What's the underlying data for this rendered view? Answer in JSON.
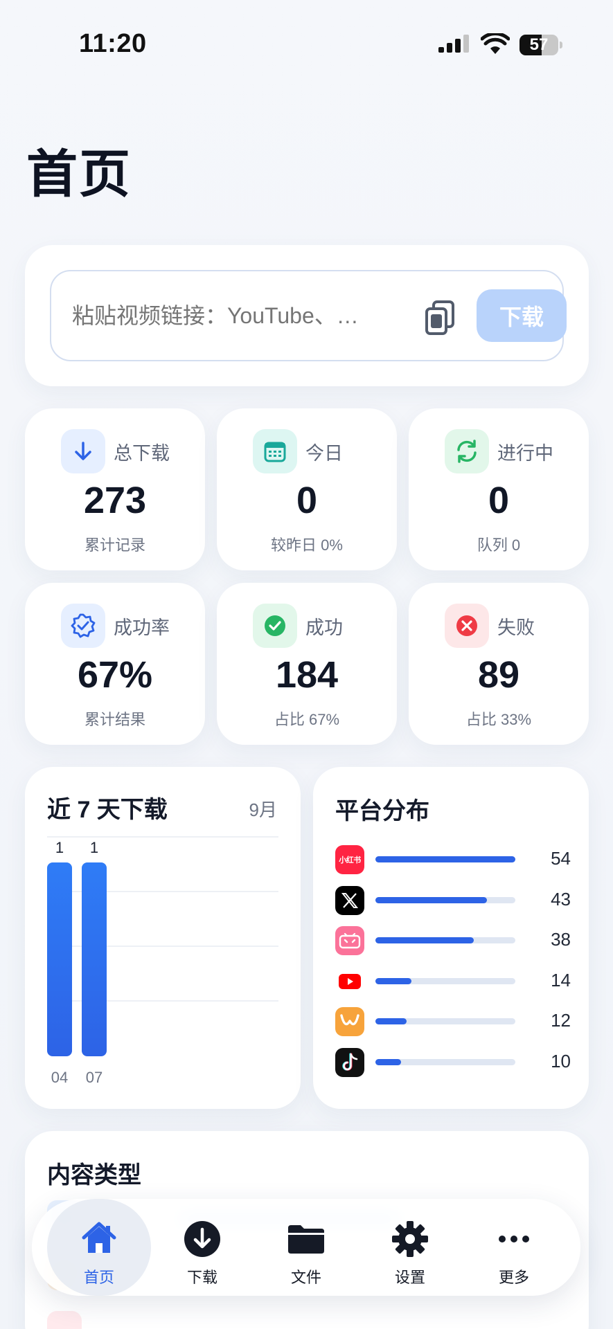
{
  "status_bar": {
    "time": "11:20",
    "battery": "57",
    "battery_level": 0.57
  },
  "page": {
    "title": "首页"
  },
  "search": {
    "placeholder": "粘贴视频链接：YouTube、…",
    "download_label": "下载"
  },
  "stats": [
    {
      "label": "总下载",
      "value": "273",
      "sub": "累计记录",
      "icon": "download-arrow-icon",
      "color": "#2d63e6",
      "bg": "#e6efff"
    },
    {
      "label": "今日",
      "value": "0",
      "sub": "较昨日 0%",
      "icon": "calendar-icon",
      "color": "#19a89a",
      "bg": "#ddf6f2"
    },
    {
      "label": "进行中",
      "value": "0",
      "sub": "队列 0",
      "icon": "sync-icon",
      "color": "#27b564",
      "bg": "#e2f7ea"
    },
    {
      "label": "成功率",
      "value": "67%",
      "sub": "累计结果",
      "icon": "verified-badge-icon",
      "color": "#2d63e6",
      "bg": "#e6efff"
    },
    {
      "label": "成功",
      "value": "184",
      "sub": "占比 67%",
      "icon": "check-circle-icon",
      "color": "#27b564",
      "bg": "#e2f7ea"
    },
    {
      "label": "失败",
      "value": "89",
      "sub": "占比 33%",
      "icon": "x-circle-icon",
      "color": "#ef3b45",
      "bg": "#fde7e8"
    }
  ],
  "chart_data": {
    "type": "bar",
    "title": "近 7 天下载",
    "month_label": "9月",
    "categories": [
      "04",
      "07"
    ],
    "values": [
      1,
      1
    ],
    "ylim": [
      0,
      1
    ],
    "grid": true,
    "color": "#2d63e6"
  },
  "platforms": {
    "title": "平台分布",
    "max": 54,
    "items": [
      {
        "name": "xiaohongshu",
        "icon": "xiaohongshu-icon",
        "glyph": "小红书",
        "count": "54",
        "value": 54,
        "color": "#ff2442"
      },
      {
        "name": "x",
        "icon": "x-twitter-icon",
        "glyph": "𝕏",
        "count": "43",
        "value": 43,
        "color": "#000000"
      },
      {
        "name": "bilibili",
        "icon": "bilibili-icon",
        "glyph": "bili",
        "count": "38",
        "value": 38,
        "color": "#fb7299"
      },
      {
        "name": "youtube",
        "icon": "youtube-icon",
        "glyph": "▶",
        "count": "14",
        "value": 14,
        "color": "#ff0000"
      },
      {
        "name": "weibo-like",
        "icon": "orange-w-icon",
        "glyph": "W",
        "count": "12",
        "value": 12,
        "color": "#f7a33b"
      },
      {
        "name": "tiktok",
        "icon": "tiktok-icon",
        "glyph": "♪",
        "count": "10",
        "value": 10,
        "color": "#111111"
      }
    ]
  },
  "content_types": {
    "title": "内容类型"
  },
  "tabs": [
    {
      "label": "首页",
      "icon": "home-icon",
      "active": true
    },
    {
      "label": "下载",
      "icon": "download-circle-icon",
      "active": false
    },
    {
      "label": "文件",
      "icon": "folder-icon",
      "active": false
    },
    {
      "label": "设置",
      "icon": "gear-icon",
      "active": false
    },
    {
      "label": "更多",
      "icon": "more-dots-icon",
      "active": false
    }
  ]
}
